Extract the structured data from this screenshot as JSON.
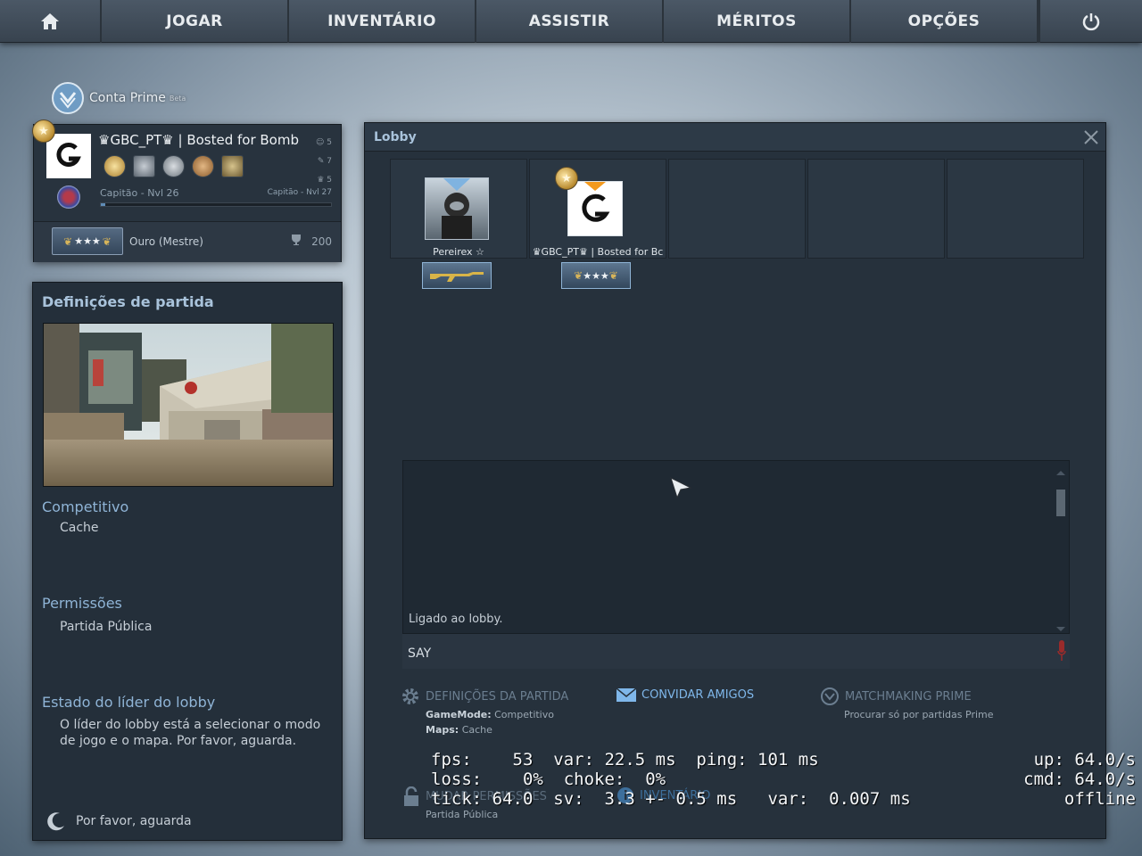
{
  "nav": {
    "items": [
      "JOGAR",
      "INVENTÁRIO",
      "ASSISTIR",
      "MÉRITOS",
      "OPÇÕES"
    ]
  },
  "prime": {
    "label": "Conta Prime",
    "tag": "Beta"
  },
  "profile": {
    "name": "♛GBC_PT♛ | Bosted for Bomb",
    "stats": [
      "5",
      "7",
      "5"
    ],
    "level_left": "Capitão - Nvl 26",
    "level_right": "Capitão - Nvl 27",
    "xp_fraction": 0.02,
    "skill_group": "Ouro (Mestre)",
    "trophy_value": "200",
    "avatar_letter": "G"
  },
  "settings": {
    "title": "Definições de partida",
    "mode_heading": "Competitivo",
    "mode_value": "Cache",
    "perm_heading": "Permissões",
    "perm_value": "Partida Pública",
    "leader_heading": "Estado do líder do lobby",
    "leader_value": "O líder do lobby está a selecionar o modo de jogo e o mapa. Por favor, aguarda.",
    "wait_label": "Por favor, aguarda"
  },
  "lobby": {
    "title": "Lobby",
    "players": [
      {
        "name": "Pereirex ☆"
      },
      {
        "name": "♛GBC_PT♛ | Bosted for Bc"
      }
    ],
    "chat_message": "Ligado ao lobby.",
    "say_label": "SAY",
    "options": {
      "match_settings": "DEFINIÇÕES DA PARTIDA",
      "gamemode_label": "GameMode:",
      "gamemode_value": "Competitivo",
      "maps_label": "Maps:",
      "maps_value": "Cache",
      "invite": "CONVIDAR AMIGOS",
      "prime_mm": "MATCHMAKING PRIME",
      "prime_mm_sub": "Procurar só por partidas Prime",
      "perm_sub": "Partida Pública",
      "perm_label_partial": "MUDAR PERMISSÕES",
      "inventory_partial": "INVENTÁRIO"
    }
  },
  "netgraph": {
    "line1": "fps:    53  var: 22.5 ms  ping: 101 ms",
    "line2": "loss:    0%  choke:  0%",
    "line3": "tick: 64.0  sv:  3.3 +- 0.5 ms   var:  0.007 ms",
    "right1": "up: 64.0/s",
    "right2": "cmd: 64.0/s",
    "right3": "offline"
  }
}
